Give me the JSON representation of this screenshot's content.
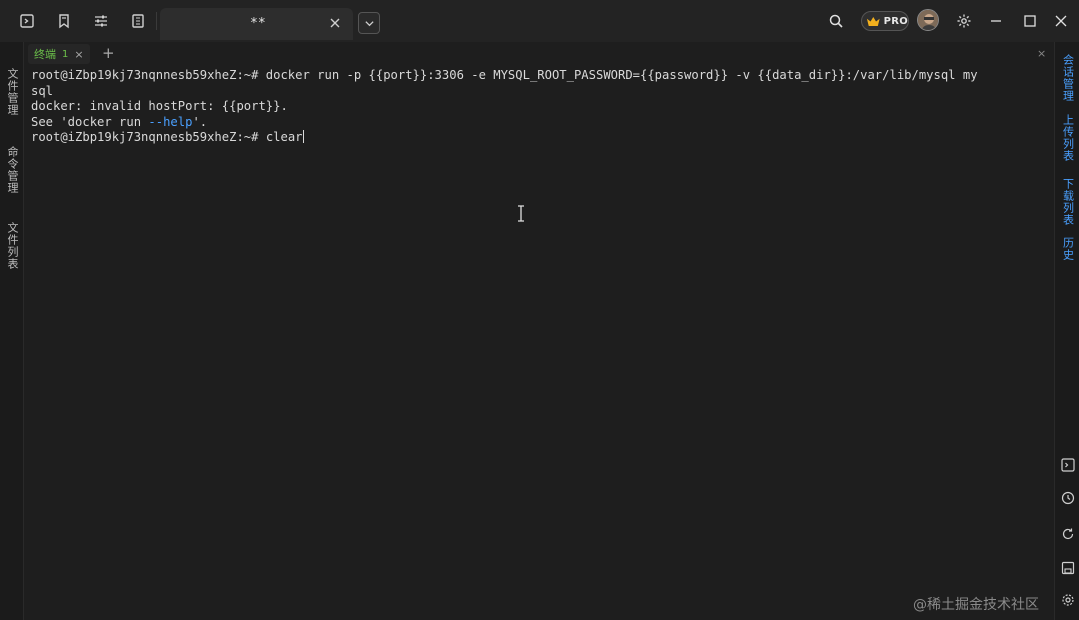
{
  "window_tab": {
    "title": "**"
  },
  "pro_badge": {
    "label": "PRO"
  },
  "session_tab": {
    "label": "终端",
    "number": "1",
    "close": "×",
    "add": "+"
  },
  "panel_close": "×",
  "left_rail": {
    "items": [
      {
        "label": "文件管理"
      },
      {
        "label": "命令管理"
      },
      {
        "label": "文件列表"
      }
    ]
  },
  "right_rail": {
    "items": [
      {
        "label": "会话管理"
      },
      {
        "label": "上传列表"
      },
      {
        "label": "下载列表"
      },
      {
        "label": "历史"
      }
    ],
    "icons": [
      "terminal-icon",
      "history-icon",
      "refresh-icon",
      "save-icon",
      "settings-icon"
    ]
  },
  "terminal": {
    "lines": [
      "root@iZbp19kj73nqnnesb59xheZ:~# docker run -p {{port}}:3306 -e MYSQL_ROOT_PASSWORD={{password}} -v {{data_dir}}:/var/lib/mysql my",
      "sql",
      "docker: invalid hostPort: {{port}}."
    ],
    "see_prefix": "See 'docker run ",
    "see_help": "--help",
    "see_suffix": "'.",
    "prompt": "root@iZbp19kj73nqnnesb59xheZ:~# ",
    "current_input": "clear"
  },
  "watermark": "@稀土掘金技术社区"
}
